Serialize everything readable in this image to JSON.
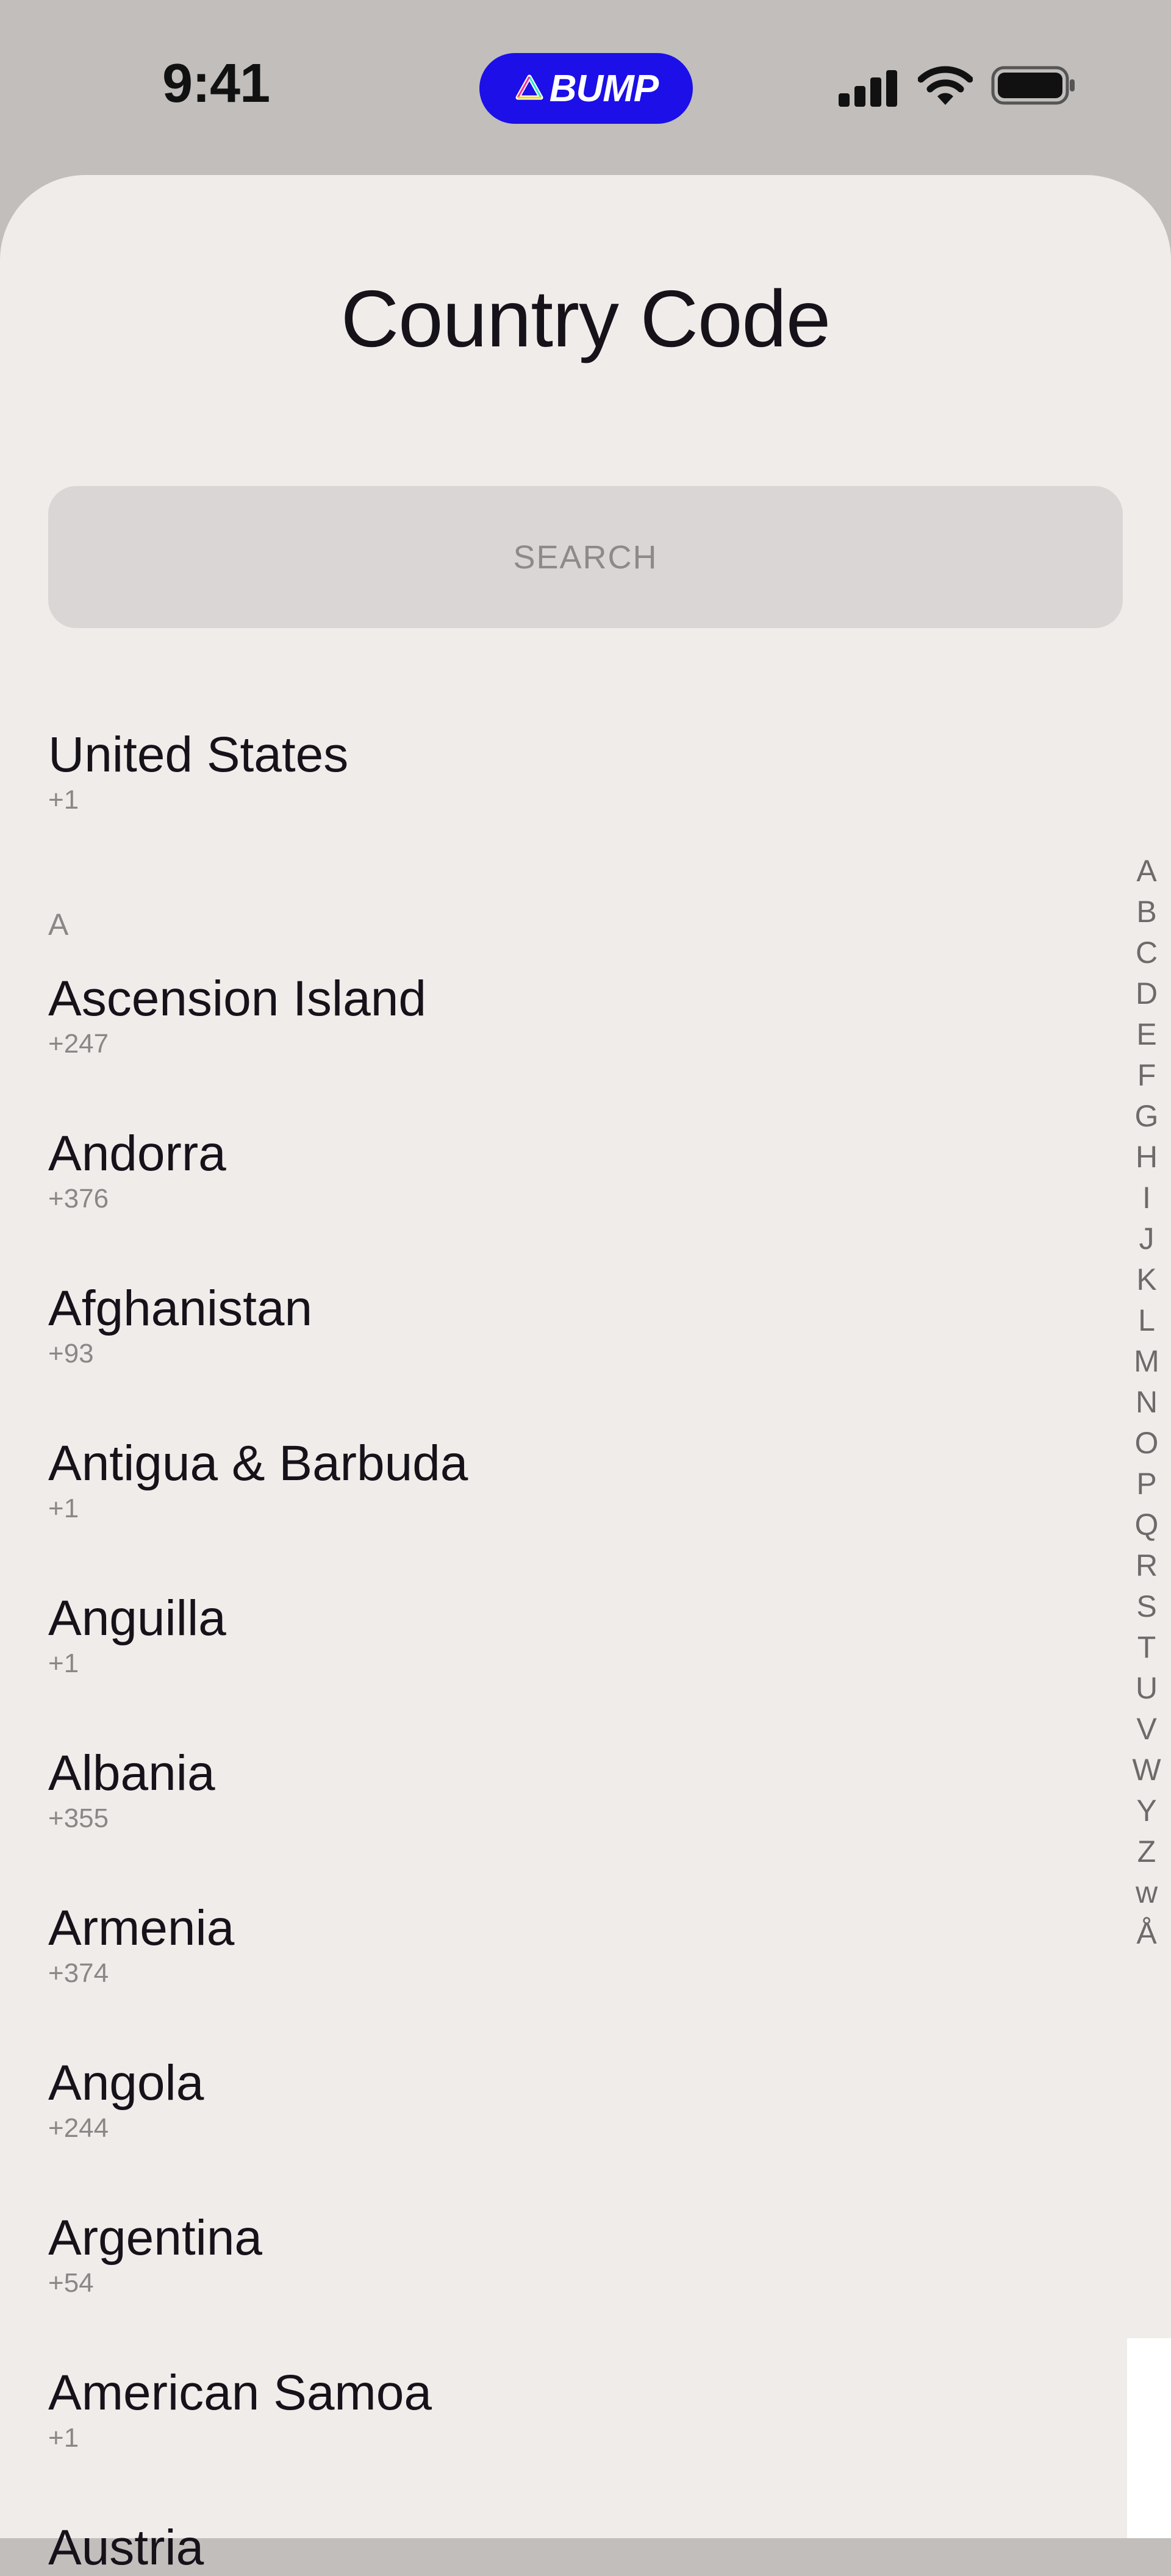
{
  "status_bar": {
    "time": "9:41",
    "app_badge": "BUMP",
    "icons": [
      "cellular-signal-icon",
      "wifi-icon",
      "battery-icon"
    ]
  },
  "colors": {
    "brand": "#1c0fe8",
    "sheet_background": "#f0ecea",
    "search_background": "#dad6d5"
  },
  "title": "Country Code",
  "search": {
    "placeholder": "SEARCH"
  },
  "featured": {
    "name": "United States",
    "code": "+1"
  },
  "section": "A",
  "countries": [
    {
      "name": "Ascension Island",
      "code": "+247"
    },
    {
      "name": "Andorra",
      "code": "+376"
    },
    {
      "name": "Afghanistan",
      "code": "+93"
    },
    {
      "name": "Antigua & Barbuda",
      "code": "+1"
    },
    {
      "name": "Anguilla",
      "code": "+1"
    },
    {
      "name": "Albania",
      "code": "+355"
    },
    {
      "name": "Armenia",
      "code": "+374"
    },
    {
      "name": "Angola",
      "code": "+244"
    },
    {
      "name": "Argentina",
      "code": "+54"
    },
    {
      "name": "American Samoa",
      "code": "+1"
    }
  ],
  "index_letters": [
    "A",
    "B",
    "C",
    "D",
    "E",
    "F",
    "G",
    "H",
    "I",
    "J",
    "K",
    "L",
    "M",
    "N",
    "O",
    "P",
    "Q",
    "R",
    "S",
    "T",
    "U",
    "V",
    "W",
    "Y",
    "Z",
    "w",
    "Å"
  ]
}
